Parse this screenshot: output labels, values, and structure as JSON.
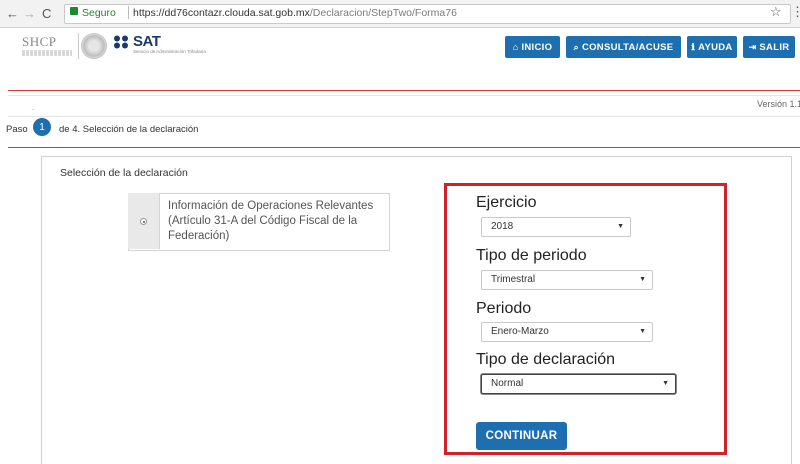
{
  "browser": {
    "secure_label": "Seguro",
    "url_host": "https://dd76contazr.clouda.sat.gob.mx",
    "url_path": "/Declaracion/StepTwo/Forma76"
  },
  "header": {
    "shcp_logo_text": "SHCP",
    "sat_logo_text": "SAT",
    "sat_logo_sub": "Servicio de Administración Tributaria",
    "buttons": {
      "inicio": "INICIO",
      "consulta": "CONSULTA/ACUSE",
      "ayuda": "AYUDA",
      "salir": "SALIR"
    }
  },
  "version_bar": {
    "dot": ".",
    "version": "Versión 1.1."
  },
  "steps": {
    "prefix": "Paso",
    "current": "1",
    "suffix": "de 4. Selección de la declaración"
  },
  "main": {
    "title": "Selección de la declaración",
    "option_text": "Información de Operaciones Relevantes (Artículo 31-A del Código Fiscal de la Federación)",
    "fields": {
      "ejercicio": {
        "label": "Ejercicio",
        "value": "2018"
      },
      "tipo_periodo": {
        "label": "Tipo de periodo",
        "value": "Trimestral"
      },
      "periodo": {
        "label": "Periodo",
        "value": "Enero-Marzo"
      },
      "tipo_declaracion": {
        "label": "Tipo de declaración",
        "value": "Normal"
      }
    },
    "continue_label": "CONTINUAR"
  },
  "colors": {
    "primary": "#1e6fb0",
    "highlight": "#d1212a",
    "secure": "#1a8a2e"
  }
}
